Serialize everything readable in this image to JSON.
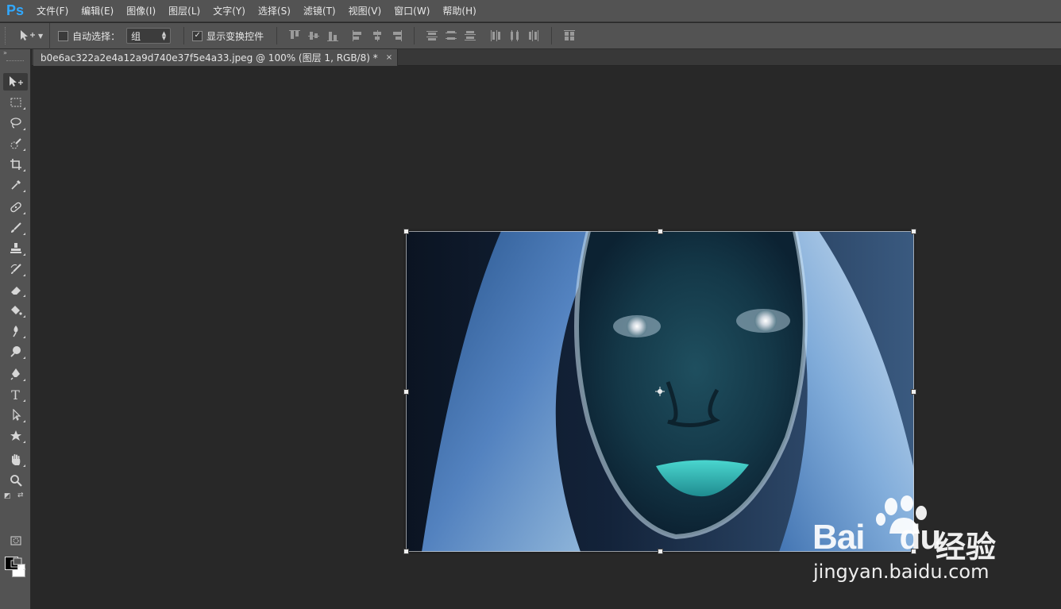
{
  "app": {
    "logo": "Ps",
    "logo_color": "#31a8ff"
  },
  "menu": [
    {
      "label": "文件(F)"
    },
    {
      "label": "编辑(E)"
    },
    {
      "label": "图像(I)"
    },
    {
      "label": "图层(L)"
    },
    {
      "label": "文字(Y)"
    },
    {
      "label": "选择(S)"
    },
    {
      "label": "滤镜(T)"
    },
    {
      "label": "视图(V)"
    },
    {
      "label": "窗口(W)"
    },
    {
      "label": "帮助(H)"
    }
  ],
  "options_bar": {
    "auto_select_label": "自动选择：",
    "auto_select_checked": false,
    "auto_select_value": "组",
    "show_transform_label": "显示变换控件",
    "show_transform_checked": true
  },
  "document_tab": {
    "title": "b0e6ac322a2e4a12a9d740e37f5e4a33.jpeg  @  100%  (图层 1, RGB/8) *",
    "close": "×"
  },
  "tools": [
    {
      "name": "move-tool",
      "icon": "move-icon"
    },
    {
      "name": "rectangular-marquee-tool",
      "icon": "marquee-icon"
    },
    {
      "name": "lasso-tool",
      "icon": "lasso-icon"
    },
    {
      "name": "quick-selection-tool",
      "icon": "quick-select-icon"
    },
    {
      "name": "crop-tool",
      "icon": "crop-icon"
    },
    {
      "name": "eyedropper-tool",
      "icon": "eyedropper-icon"
    },
    {
      "name": "spot-healing-tool",
      "icon": "bandage-icon"
    },
    {
      "name": "brush-tool",
      "icon": "brush-icon"
    },
    {
      "name": "clone-stamp-tool",
      "icon": "stamp-icon"
    },
    {
      "name": "history-brush-tool",
      "icon": "history-brush-icon"
    },
    {
      "name": "eraser-tool",
      "icon": "eraser-icon"
    },
    {
      "name": "paint-bucket-tool",
      "icon": "bucket-icon"
    },
    {
      "name": "blur-tool",
      "icon": "blur-icon"
    },
    {
      "name": "dodge-tool",
      "icon": "dodge-icon"
    },
    {
      "name": "pen-tool",
      "icon": "pen-icon"
    },
    {
      "name": "type-tool",
      "icon": "type-icon",
      "glyph": "T"
    },
    {
      "name": "path-selection-tool",
      "icon": "path-select-icon"
    },
    {
      "name": "custom-shape-tool",
      "icon": "shape-icon"
    },
    {
      "name": "hand-tool",
      "icon": "hand-icon"
    },
    {
      "name": "zoom-tool",
      "icon": "zoom-icon"
    }
  ],
  "colors": {
    "foreground": "#000000",
    "background": "#ffffff"
  },
  "watermark": {
    "brand": "Bai",
    "brand_suffix": "du",
    "product": "经验",
    "url": "jingyan.baidu.com"
  }
}
